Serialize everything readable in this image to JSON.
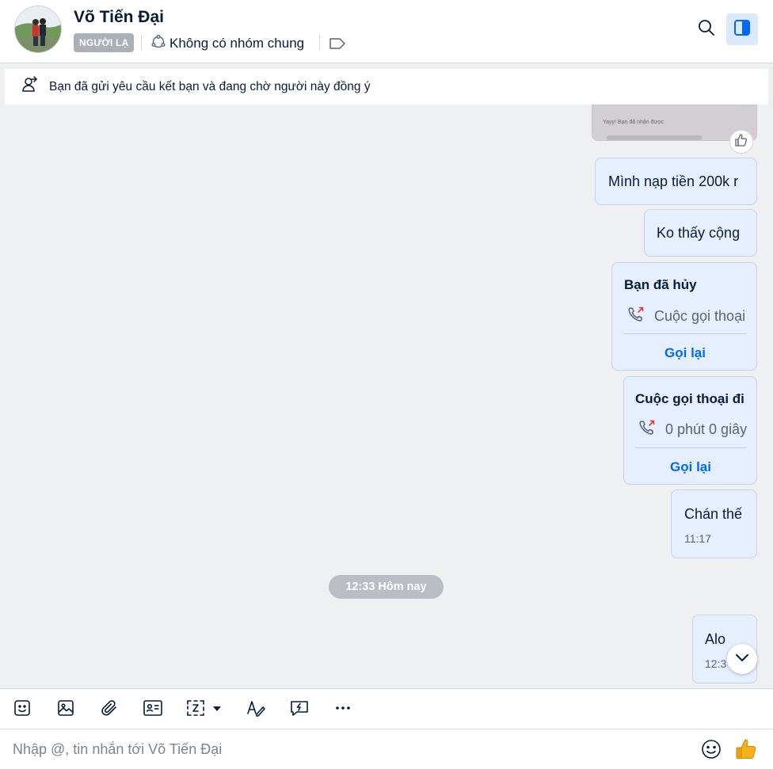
{
  "header": {
    "contact_name": "Võ Tiến Đại",
    "badge": "NGƯỜI LẠ",
    "group_info": "Không có nhóm chung",
    "icons": [
      "search-icon",
      "side-panel-icon",
      "tag-icon",
      "group-icon"
    ]
  },
  "banner": {
    "text": "Bạn đã gửi yêu cầu kết bạn và đang chờ người này đồng ý",
    "icon": "add-user-icon"
  },
  "messages": {
    "image_preview_text": "Yayy! Bạn đã nhận được",
    "m1": "Mình nạp tiền 200k r",
    "m2": "Ko thấy cộng",
    "call1": {
      "title": "Bạn đã hủy",
      "detail": "Cuộc gọi thoại",
      "action": "Gọi lại"
    },
    "call2": {
      "title": "Cuộc gọi thoại đi",
      "detail": "0 phút 0 giây",
      "action": "Gọi lại"
    },
    "m3": {
      "text": "Chán thế",
      "time": "11:17"
    },
    "date_divider": "12:33 Hôm nay",
    "m4": {
      "text": "Alo",
      "time": "12:3"
    }
  },
  "toolbar": {
    "items": [
      "sticker-icon",
      "image-icon",
      "attach-icon",
      "contact-card-icon",
      "screenshot-icon",
      "format-text-icon",
      "quick-message-icon",
      "more-icon"
    ]
  },
  "composer": {
    "placeholder": "Nhập @, tin nhắn tới Võ Tiến Đại"
  },
  "colors": {
    "accent": "#0068ff",
    "bubble": "#e5efff",
    "background": "#eef0f1",
    "badge": "#a9b0b8",
    "missed_call": "#e5383b"
  }
}
